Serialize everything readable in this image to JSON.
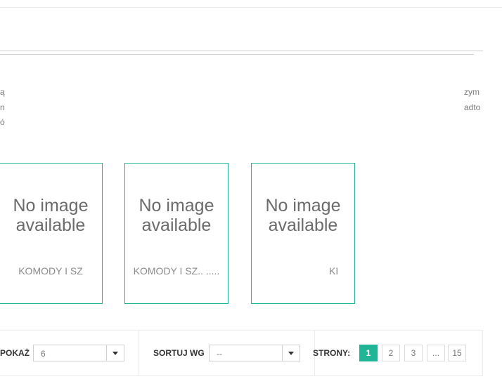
{
  "intro": {
    "left_lines": [
      "ą",
      "n",
      "ó"
    ],
    "right_lines": [
      "zym",
      "adto"
    ]
  },
  "products": [
    {
      "image_text": "No image available",
      "name": "KOMODY I SZ"
    },
    {
      "image_text": "No image available",
      "name": "KOMODY I SZ.. ....."
    },
    {
      "image_text": "No image available",
      "name": "KI"
    }
  ],
  "toolbar": {
    "show_label": "POKAŻ",
    "show_value": "6",
    "sort_label": "SORTUJ WG",
    "sort_value": "--",
    "pages_label": "STRONY:",
    "pages": [
      "1",
      "2",
      "3",
      "...",
      "15"
    ]
  },
  "colors": {
    "accent": "#1fb596"
  }
}
